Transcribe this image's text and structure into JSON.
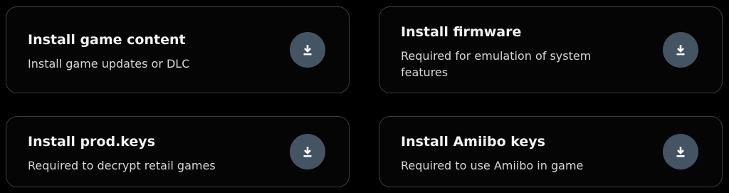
{
  "cards": [
    {
      "title": "Install game content",
      "description": "Install game updates or DLC",
      "icon": "download-icon"
    },
    {
      "title": "Install firmware",
      "description": "Required for emulation of system features",
      "icon": "download-icon"
    },
    {
      "title": "Install prod.keys",
      "description": "Required to decrypt retail games",
      "icon": "download-icon"
    },
    {
      "title": "Install Amiibo keys",
      "description": "Required to use Amiibo in game",
      "icon": "download-icon"
    }
  ],
  "colors": {
    "background": "#000000",
    "card_border": "#3a3d42",
    "icon_button": "#455463",
    "icon_glyph": "#ffffff"
  }
}
